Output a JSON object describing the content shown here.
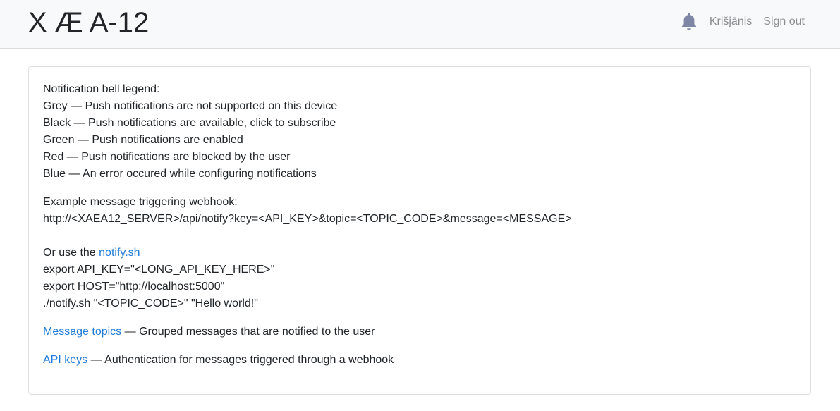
{
  "header": {
    "brand": "X Æ A-12",
    "user_link": "Krišjānis",
    "signout_link": "Sign out",
    "bell_icon": "bell-icon",
    "bell_color": "#7d86a5"
  },
  "legend": {
    "title": "Notification bell legend:",
    "lines": [
      "Grey — Push notifications are not supported on this device",
      "Black — Push notifications are available, click to subscribe",
      "Green — Push notifications are enabled",
      "Red — Push notifications are blocked by the user",
      "Blue — An error occured while configuring notifications"
    ]
  },
  "webhook": {
    "title": "Example message triggering webhook:",
    "url": "http://<XAEA12_SERVER>/api/notify?key=<API_KEY>&topic=<TOPIC_CODE>&message=<MESSAGE>"
  },
  "script": {
    "intro": "Or use the ",
    "link": "notify.sh",
    "lines": [
      "export API_KEY=\"<LONG_API_KEY_HERE>\"",
      "export HOST=\"http://localhost:5000\"",
      "./notify.sh \"<TOPIC_CODE>\" \"Hello world!\""
    ]
  },
  "topics": {
    "link": "Message topics",
    "desc": " — Grouped messages that are notified to the user"
  },
  "apikeys": {
    "link": "API keys",
    "desc": " — Authentication for messages triggered through a webhook"
  },
  "colors": {
    "link": "#1e7bd8",
    "nav_link": "#8a8e92",
    "navbar_bg": "#f8f9fa"
  }
}
